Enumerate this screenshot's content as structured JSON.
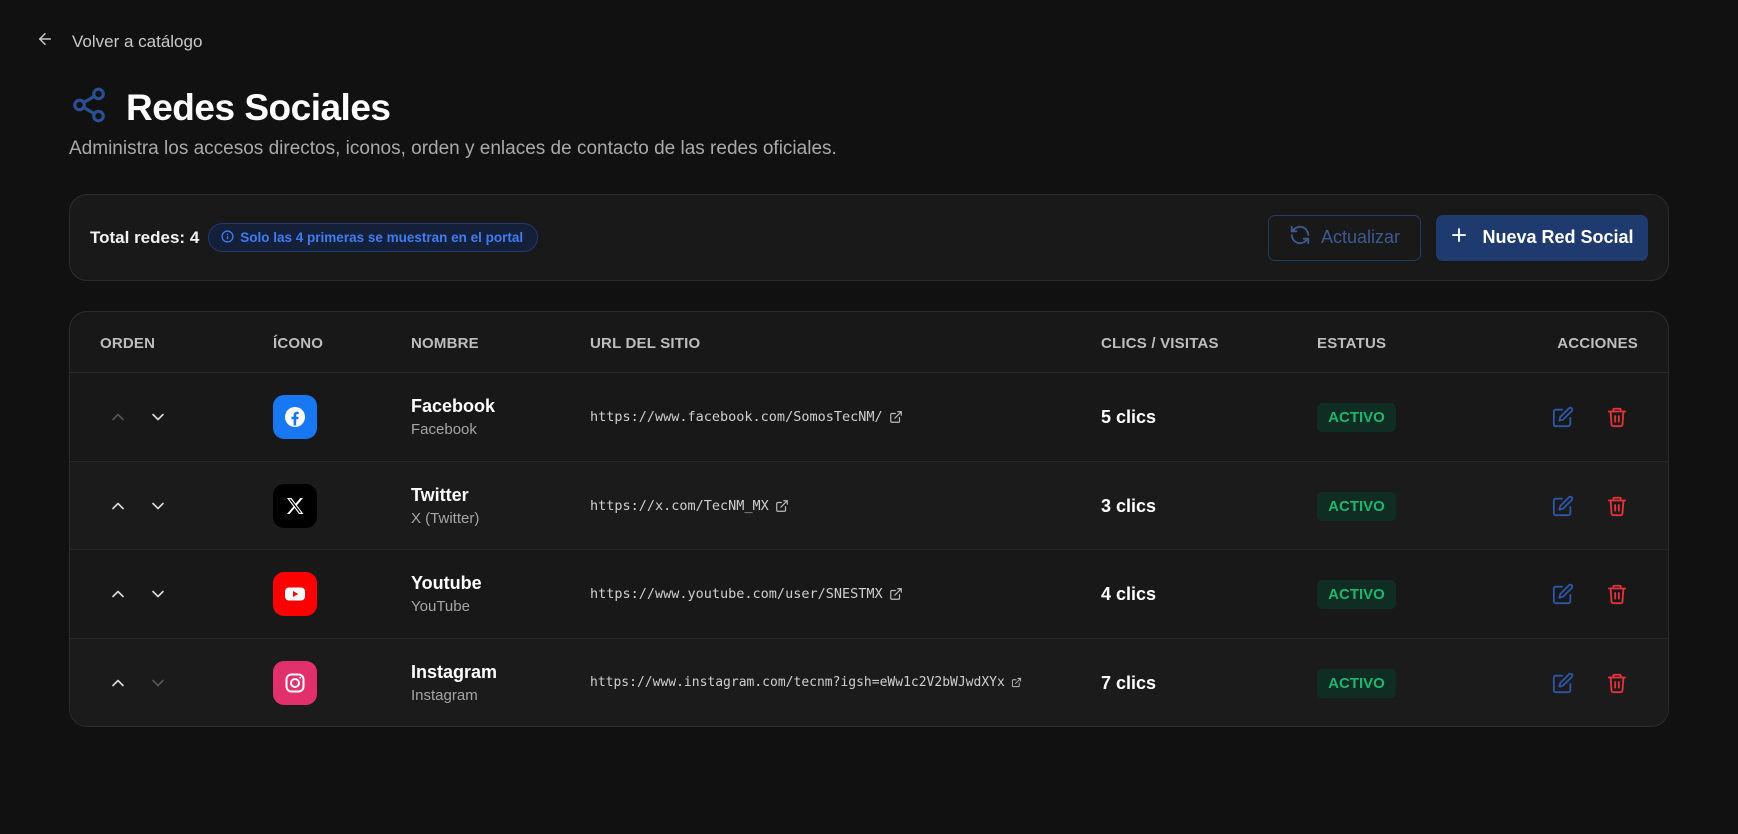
{
  "nav": {
    "back_label": "Volver a catálogo"
  },
  "header": {
    "title": "Redes Sociales",
    "subtitle": "Administra los accesos directos, iconos, orden y enlaces de contacto de las redes oficiales.",
    "icon": "share-icon"
  },
  "toolbar": {
    "total_label": "Total redes: 4",
    "info_text": "Solo las 4 primeras se muestran en el portal",
    "refresh_label": "Actualizar",
    "new_label": "Nueva Red Social"
  },
  "table": {
    "columns": [
      "ORDEN",
      "ÍCONO",
      "NOMBRE",
      "URL DEL SITIO",
      "CLICS / VISITAS",
      "ESTATUS",
      "ACCIONES"
    ],
    "rows": [
      {
        "name": "Facebook",
        "platform": "Facebook",
        "url": "https://www.facebook.com/SomosTecNM/",
        "clicks": "5 clics",
        "status": "ACTIVO",
        "icon": "facebook-icon",
        "icon_bg": "#1877f2",
        "up_enabled": false,
        "down_enabled": true
      },
      {
        "name": "Twitter",
        "platform": "X (Twitter)",
        "url": "https://x.com/TecNM_MX",
        "clicks": "3 clics",
        "status": "ACTIVO",
        "icon": "x-icon",
        "icon_bg": "#000000",
        "up_enabled": true,
        "down_enabled": true
      },
      {
        "name": "Youtube",
        "platform": "YouTube",
        "url": "https://www.youtube.com/user/SNESTMX",
        "clicks": "4 clics",
        "status": "ACTIVO",
        "icon": "youtube-icon",
        "icon_bg": "#ff0000",
        "up_enabled": true,
        "down_enabled": true
      },
      {
        "name": "Instagram",
        "platform": "Instagram",
        "url": "https://www.instagram.com/tecnm?igsh=eWw1c2V2bWJwdXYx",
        "clicks": "7 clics",
        "status": "ACTIVO",
        "icon": "instagram-icon",
        "icon_bg": "#e1306c",
        "up_enabled": true,
        "down_enabled": false
      }
    ]
  },
  "colors": {
    "background": "#111111",
    "card": "#191919",
    "accent": "#1e3a6e",
    "info": "#3f7cf0",
    "success": "#1fb56e",
    "danger": "#e5323b"
  }
}
